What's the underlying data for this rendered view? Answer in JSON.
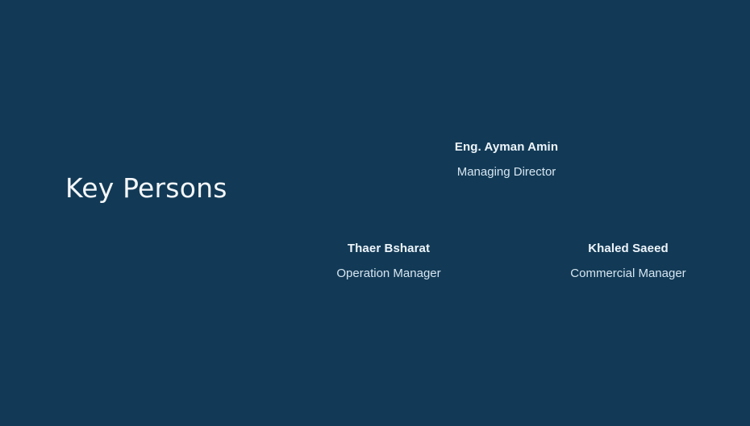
{
  "slide": {
    "title": "Key Persons",
    "people": [
      {
        "name": "Eng. Ayman Amin",
        "role": "Managing Director"
      },
      {
        "name": "Thaer Bsharat",
        "role": "Operation Manager"
      },
      {
        "name": "Khaled Saeed",
        "role": "Commercial Manager"
      }
    ]
  },
  "colors": {
    "background": "#123a56",
    "title": "#f4f7fa",
    "name": "#eef5fb",
    "role": "#d6e5f1"
  }
}
